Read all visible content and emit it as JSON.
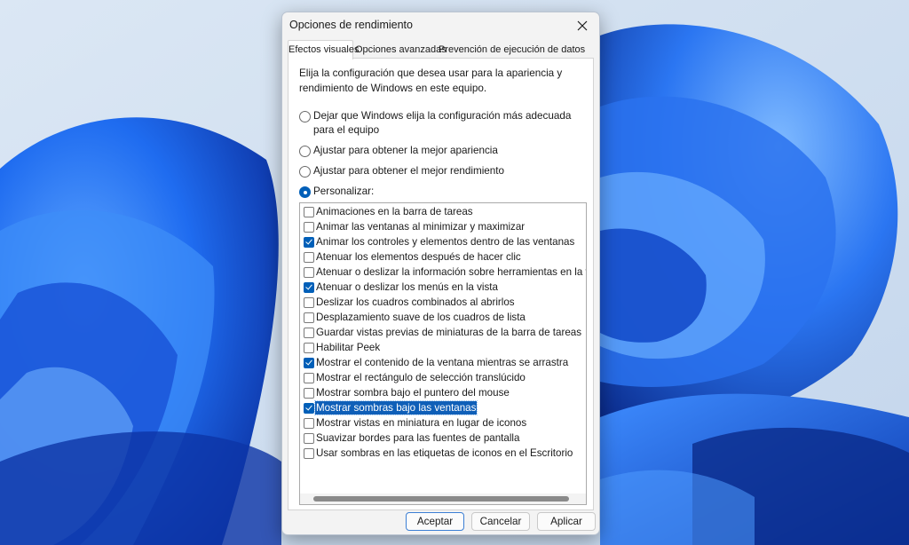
{
  "dialog": {
    "title": "Opciones de rendimiento",
    "tabs": [
      {
        "label": "Efectos visuales",
        "active": true
      },
      {
        "label": "Opciones avanzadas",
        "active": false
      },
      {
        "label": "Prevención de ejecución de datos",
        "active": false
      }
    ],
    "intro": "Elija la configuración que desea usar para la apariencia y rendimiento de Windows en este equipo.",
    "radios": [
      {
        "label": "Dejar que Windows elija la configuración más adecuada para el equipo",
        "checked": false
      },
      {
        "label": "Ajustar para obtener la mejor apariencia",
        "checked": false
      },
      {
        "label": "Ajustar para obtener el mejor rendimiento",
        "checked": false
      },
      {
        "label": "Personalizar:",
        "checked": true
      }
    ],
    "effects": [
      {
        "label": "Animaciones en la barra de tareas",
        "checked": false
      },
      {
        "label": "Animar las ventanas al minimizar y maximizar",
        "checked": false
      },
      {
        "label": "Animar los controles y elementos dentro de las ventanas",
        "checked": true
      },
      {
        "label": "Atenuar los elementos después de hacer clic",
        "checked": false
      },
      {
        "label": "Atenuar o deslizar la información sobre herramientas en la vista",
        "checked": false
      },
      {
        "label": "Atenuar o deslizar los menús en la vista",
        "checked": true
      },
      {
        "label": "Deslizar los cuadros combinados al abrirlos",
        "checked": false
      },
      {
        "label": "Desplazamiento suave de los cuadros de lista",
        "checked": false
      },
      {
        "label": "Guardar vistas previas de miniaturas de la barra de tareas",
        "checked": false
      },
      {
        "label": "Habilitar Peek",
        "checked": false
      },
      {
        "label": "Mostrar el contenido de la ventana mientras se arrastra",
        "checked": true
      },
      {
        "label": "Mostrar el rectángulo de selección translúcido",
        "checked": false
      },
      {
        "label": "Mostrar sombra bajo el puntero del mouse",
        "checked": false
      },
      {
        "label": "Mostrar sombras bajo las ventanas",
        "checked": true,
        "selected": true
      },
      {
        "label": "Mostrar vistas en miniatura en lugar de iconos",
        "checked": false
      },
      {
        "label": "Suavizar bordes para las fuentes de pantalla",
        "checked": false
      },
      {
        "label": "Usar sombras en las etiquetas de iconos en el Escritorio",
        "checked": false
      }
    ],
    "buttons": {
      "ok": "Aceptar",
      "cancel": "Cancelar",
      "apply": "Aplicar"
    }
  },
  "colors": {
    "accent": "#005fb8",
    "selection": "#0f5fb8",
    "dialog_bg": "#f3f3f3",
    "panel_bg": "#ffffff",
    "wallpaper_light": "#cfdff0",
    "wallpaper_blue": "#1f5fe0"
  }
}
